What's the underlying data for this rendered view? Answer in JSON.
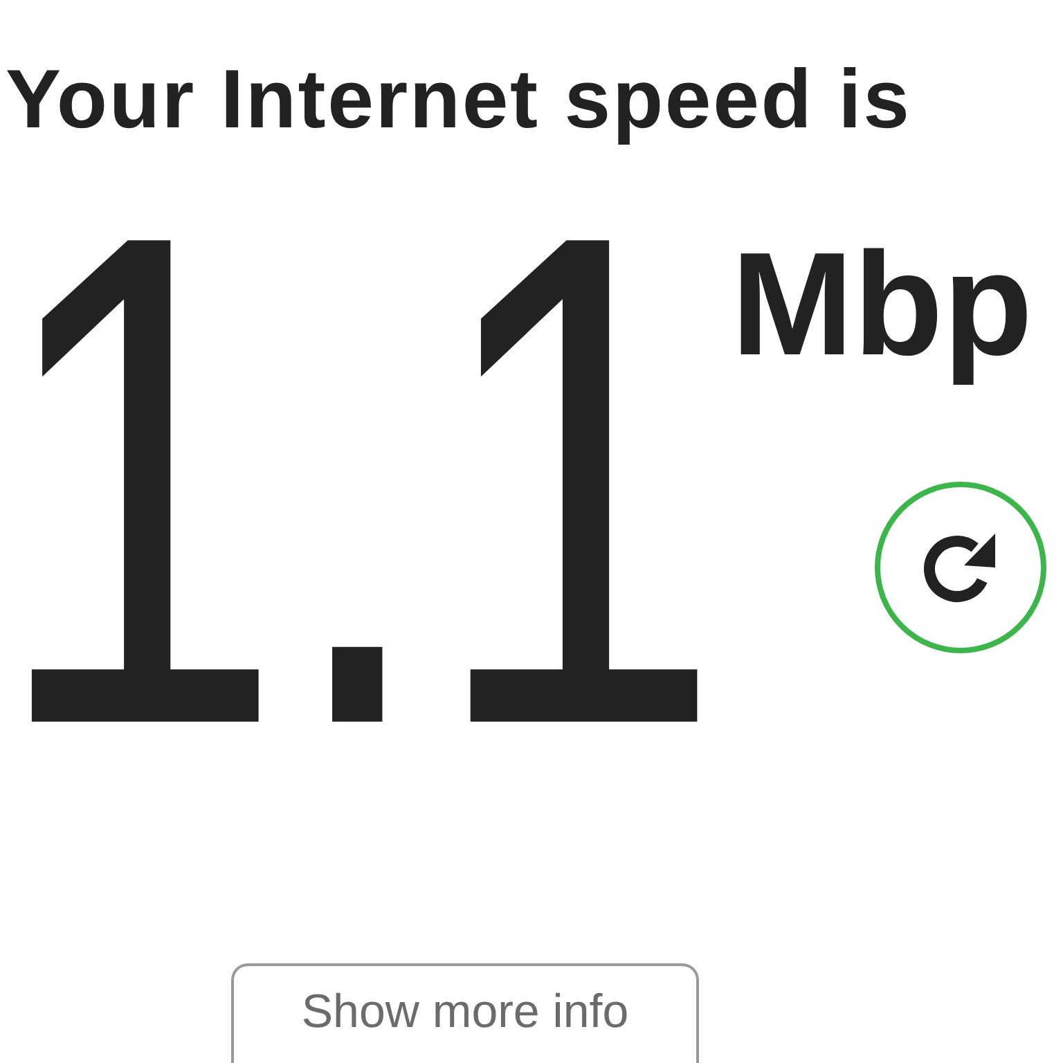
{
  "heading": "Your Internet speed is",
  "speed": {
    "value": "1.1",
    "unit": "Mbp"
  },
  "more_info_button": {
    "label": "Show more info"
  }
}
